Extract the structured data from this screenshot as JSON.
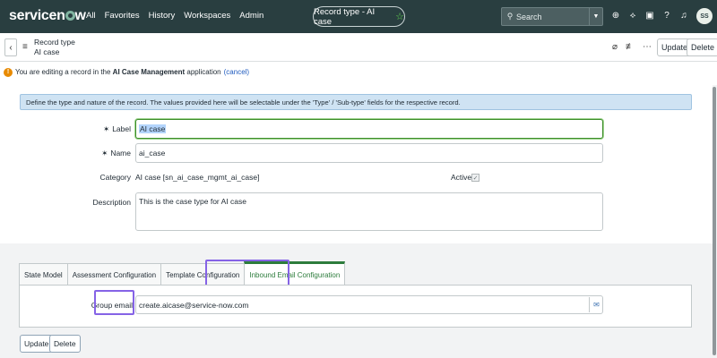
{
  "nav": {
    "logo": "servicenow",
    "links": [
      "All",
      "Favorites",
      "History",
      "Workspaces",
      "Admin"
    ],
    "pill_title": "Record type - AI case",
    "search_placeholder": "Search",
    "avatar": "SS"
  },
  "header": {
    "line1": "Record type",
    "line2": "AI case",
    "update_label": "Update",
    "delete_label": "Delete"
  },
  "warning": {
    "prefix": "You are editing a record in the ",
    "app": "AI Case Management",
    "suffix": " application",
    "cancel": "(cancel)"
  },
  "info": "Define the type and nature of the record. The values provided here will be selectable under the 'Type' / 'Sub-type' fields for the respective record.",
  "form": {
    "label_label": "Label",
    "label_value": "AI case",
    "name_label": "Name",
    "name_value": "ai_case",
    "category_label": "Category",
    "category_value": "AI case [sn_ai_case_mgmt_ai_case]",
    "active_label": "Active",
    "active_checked": true,
    "description_label": "Description",
    "description_value": "This is the case type for AI case"
  },
  "tabs": [
    "State Model",
    "Assessment Configuration",
    "Template Configuration",
    "Inbound Email Configuration"
  ],
  "active_tab": 3,
  "email": {
    "label": "Group email",
    "value": "create.aicase@service-now.com"
  },
  "footer": {
    "update_label": "Update",
    "delete_label": "Delete"
  },
  "colors": {
    "nav_bg": "#293e40",
    "highlight": "#8563e6",
    "active_tab": "#2d7c3c"
  }
}
